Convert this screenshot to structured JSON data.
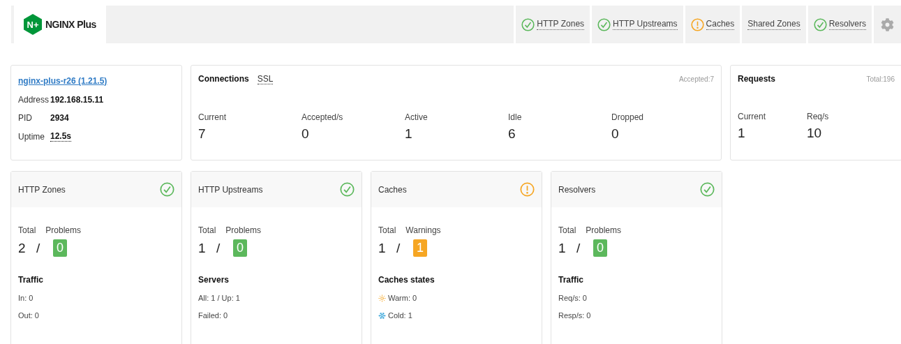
{
  "logo": {
    "mark": "N+",
    "name": "NGINX Plus"
  },
  "nav": [
    {
      "label": "HTTP Zones",
      "kind": "check",
      "color": "#5cb85c"
    },
    {
      "label": "HTTP Upstreams",
      "kind": "check",
      "color": "#5cb85c"
    },
    {
      "label": "Caches",
      "kind": "alert",
      "color": "#f6a623"
    },
    {
      "label": "Shared Zones",
      "kind": "plain"
    },
    {
      "label": "Resolvers",
      "kind": "check",
      "color": "#5cb85c"
    }
  ],
  "server": {
    "name": "nginx-plus-r26 (1.21.5)",
    "fields": [
      {
        "label": "Address",
        "value": "192.168.15.11",
        "underlined": false
      },
      {
        "label": "PID",
        "value": "2934",
        "underlined": false
      },
      {
        "label": "Uptime",
        "value": "12.5s",
        "underlined": true
      }
    ]
  },
  "connections": {
    "title": "Connections",
    "tab": "SSL",
    "note": "Accepted:7",
    "metrics": [
      {
        "label": "Current",
        "value": "7"
      },
      {
        "label": "Accepted/s",
        "value": "0"
      },
      {
        "label": "Active",
        "value": "1"
      },
      {
        "label": "Idle",
        "value": "6"
      },
      {
        "label": "Dropped",
        "value": "0"
      }
    ]
  },
  "requests": {
    "title": "Requests",
    "note": "Total:196",
    "metrics": [
      {
        "label": "Current",
        "value": "1"
      },
      {
        "label": "Req/s",
        "value": "10"
      }
    ]
  },
  "summaries": [
    {
      "title": "HTTP Zones",
      "kind": "check",
      "color": "#5cb85c",
      "total_label": "Total",
      "problems_label": "Problems",
      "total": "2",
      "separator": "/",
      "problems": "0",
      "section": "Traffic",
      "lines": [
        {
          "kind": "plain",
          "text": "In: 0"
        },
        {
          "kind": "plain",
          "text": "Out: 0"
        }
      ]
    },
    {
      "title": "HTTP Upstreams",
      "kind": "check",
      "color": "#5cb85c",
      "total_label": "Total",
      "problems_label": "Problems",
      "total": "1",
      "separator": "/",
      "problems": "0",
      "section": "Servers",
      "lines": [
        {
          "kind": "plain",
          "text": "All: 1 / Up: 1"
        },
        {
          "kind": "plain",
          "text": "Failed: 0"
        }
      ]
    },
    {
      "title": "Caches",
      "kind": "alert",
      "color": "#f6a623",
      "total_label": "Total",
      "problems_label": "Warnings",
      "total": "1",
      "separator": "/",
      "problems": "1",
      "section": "Caches states",
      "lines": [
        {
          "kind": "warm",
          "text": "Warm: 0"
        },
        {
          "kind": "cold",
          "text": "Cold: 1"
        }
      ]
    },
    {
      "title": "Resolvers",
      "kind": "check",
      "color": "#5cb85c",
      "total_label": "Total",
      "problems_label": "Problems",
      "total": "1",
      "separator": "/",
      "problems": "0",
      "section": "Traffic",
      "lines": [
        {
          "kind": "plain",
          "text": "Req/s: 0"
        },
        {
          "kind": "plain",
          "text": "Resp/s: 0"
        }
      ]
    }
  ]
}
